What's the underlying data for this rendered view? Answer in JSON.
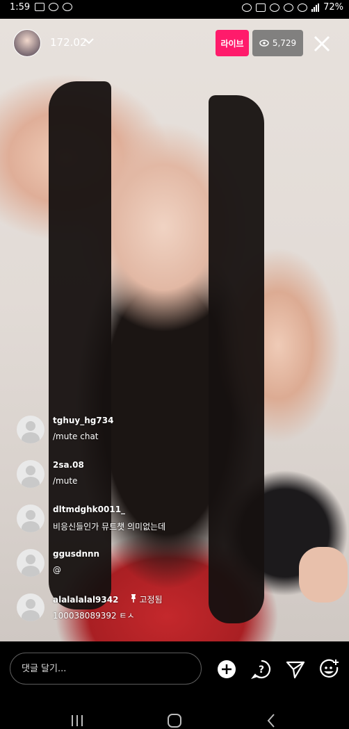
{
  "status_bar": {
    "time": "1:59",
    "battery": "72%"
  },
  "header": {
    "username": "172.02",
    "live_label": "라이브",
    "viewer_count": "5,729"
  },
  "comments": [
    {
      "user": "tghuy_hg734",
      "text": "/mute chat"
    },
    {
      "user": "2sa.08",
      "text": "/mute"
    },
    {
      "user": "dltmdghk0011_",
      "text": "비응신들인가 뮤트챗 의미없는데"
    },
    {
      "user": "ggusdnnn",
      "text": "@"
    },
    {
      "user": "alalalalal9342",
      "pinned": "고정됨",
      "text": "100038089392 ㅌㅅ"
    }
  ],
  "composer": {
    "placeholder": "댓글 달기..."
  },
  "icons": {
    "close": "close-icon",
    "eye": "eye-icon",
    "add": "add-circle-icon",
    "question": "question-icon",
    "send": "send-icon",
    "emoji": "emoji-add-icon",
    "pin": "pin-icon"
  },
  "colors": {
    "live": "#ff1b6b",
    "viewers_bg": "#6e6e6e",
    "background": "#000000"
  }
}
